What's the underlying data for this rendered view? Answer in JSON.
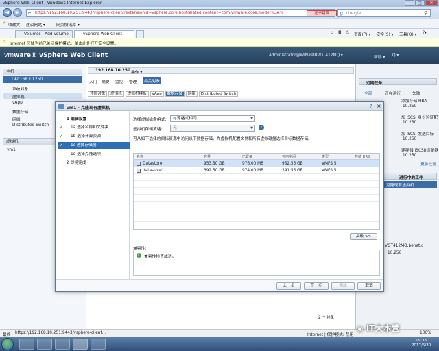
{
  "browser": {
    "title": "vSphere Web Client - Windows Internet Explorer",
    "url": "https://192.168.10.251:9443/vsphere-client/?extensionId=vsphere.core.hostrelated.content=com.vmware.core.model%3A%",
    "cert_error": "证书错误",
    "search_placeholder": "Google",
    "favorites_label": "收藏夹",
    "favorites": [
      "建议网站 ▾",
      "网页快讯库 ▾"
    ],
    "tabs": [
      "Volumes : Add Volume",
      "vSphere Web Client"
    ],
    "tools": [
      "页面(P) ▾",
      "安全(S) ▾",
      "工具(O) ▾",
      "?▾"
    ],
    "infobar": "Internet 区域当前已关闭保护模式。单击此处打开安全设置。",
    "status_url": "https://192.168.10.251:9443/vsphere-client...",
    "status_prefix": "最终",
    "status_zone": "Internet | 保护模式: 禁用",
    "zoom": "100%"
  },
  "vsphere": {
    "logo_brand": "vm",
    "logo_rest": "ware® vSphere Web Client",
    "user": "Administrator@WIN-B8RVQT412MQ ▾",
    "help_items": [
      "帮助 ▾",
      "Q ▾"
    ],
    "left": {
      "host_header": "主机",
      "host": "192.168.10.250",
      "nav": [
        "系统对象",
        "虚拟机",
        "vApp",
        "数据存储",
        "网络",
        "Distributed Switch"
      ],
      "vm_header": "虚拟机",
      "vm": "vm1"
    },
    "mid": {
      "host": "192.168.10.250",
      "actions": "操作 ▾",
      "tabs": [
        "入门",
        "摘要",
        "监控",
        "管理",
        "相关对象"
      ],
      "subtabs": [
        "顶层对象",
        "虚拟机",
        "虚拟机模板",
        "vApp",
        "数据存储",
        "网络",
        "Distributed Switch"
      ],
      "items_count": "2 个对象"
    },
    "right": {
      "title": "近期任务",
      "tabs": [
        "全部",
        "正在运行",
        "失败"
      ],
      "lines": [
        "添加存储 HBA",
        "10.250",
        "加 iSCSI 身份验证配",
        "10.250",
        "加 iSCSI 发送目标",
        "10.250",
        "连存储(iSCSI)适配器",
        "10.250",
        "更多任务",
        "进行中的工作",
        "克隆现有虚拟机",
        "VQT412MQ.benet.c",
        "10.250"
      ]
    }
  },
  "dialog": {
    "title": "vm1 - 克隆现有虚拟机",
    "steps": [
      {
        "label": "1 编辑设置",
        "done": false
      },
      {
        "label": "1a 选择名称和文件夹",
        "done": true
      },
      {
        "label": "1b 选择计算资源",
        "done": true
      },
      {
        "label": "1c 选择存储器",
        "done": true
      },
      {
        "label": "1d 选择克隆选项",
        "done": false
      },
      {
        "label": "2 即将完成",
        "done": false
      }
    ],
    "active_step": 3,
    "disk_format_label": "选择虚拟磁盘格式:",
    "disk_format_value": "与源格式相同",
    "policy_label": "虚拟机存储策略:",
    "policy_value": "无",
    "info_text": "可从如下选择的目标资源中访问以下数据存储。为虚拟机配置文件和所有虚拟磁盘选择目标数据存储。",
    "columns": [
      "名称",
      "容量",
      "已置备",
      "可用空间",
      "类型",
      "存储 DRS"
    ],
    "rows": [
      {
        "name": "Datastore",
        "capacity": "953.50 GB",
        "provisioned": "976.00 MB",
        "free": "952.55 GB",
        "type": "VMFS 5",
        "drs": ""
      },
      {
        "name": "datastore1",
        "capacity": "392.50 GB",
        "provisioned": "974.00 MB",
        "free": "391.55 GB",
        "type": "VMFS 5",
        "drs": ""
      }
    ],
    "advanced_button": "高级 >>",
    "compat_label": "兼容性:",
    "compat_ok": "兼容性检查成功。",
    "buttons": {
      "back": "上一步",
      "next": "下一步",
      "finish": "完成",
      "cancel": "取消"
    }
  },
  "taskbar": {
    "time": "19:33",
    "date": "2017/5/30"
  },
  "watermark": "IT大本营"
}
